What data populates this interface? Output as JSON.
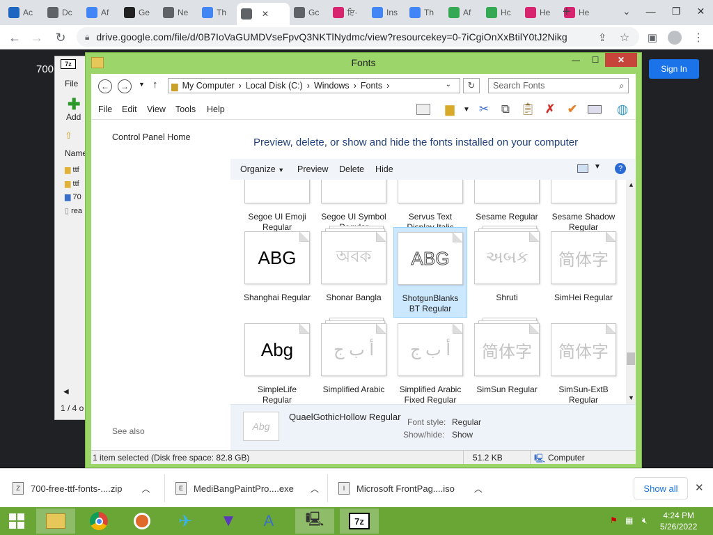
{
  "browser": {
    "tabs": [
      {
        "title": "Ac",
        "icon": "a-icon",
        "color": "#1f66c1"
      },
      {
        "title": "Dc",
        "icon": "globe-icon",
        "color": "#5f6368"
      },
      {
        "title": "Af",
        "icon": "map-pin-icon",
        "color": "#4285f4"
      },
      {
        "title": "Ge",
        "icon": "g-icon",
        "color": "#222222"
      },
      {
        "title": "Ne",
        "icon": "chrome-icon",
        "color": "#5f6368"
      },
      {
        "title": "Th",
        "icon": "map-pin-icon",
        "color": "#4285f4"
      },
      {
        "title": "",
        "icon": "globe-icon",
        "color": "#5f6368",
        "active": true
      },
      {
        "title": "Gc",
        "icon": "globe-icon",
        "color": "#5f6368"
      },
      {
        "title": "ਇ·",
        "icon": "ampersand-icon",
        "color": "#d6246e"
      },
      {
        "title": "Ins",
        "icon": "map-pin-icon",
        "color": "#4285f4"
      },
      {
        "title": "Th",
        "icon": "map-pin-icon",
        "color": "#4285f4"
      },
      {
        "title": "Af",
        "icon": "circle-icon",
        "color": "#34a853"
      },
      {
        "title": "Hc",
        "icon": "circle-icon",
        "color": "#34a853"
      },
      {
        "title": "He",
        "icon": "ampersand-icon",
        "color": "#d6246e"
      },
      {
        "title": "He",
        "icon": "ampersand-icon",
        "color": "#d6246e"
      }
    ],
    "tab_close": "✕",
    "new_tab": "+",
    "url": "drive.google.com/file/d/0B7IoVaGUMDVseFpvQ3NKTlNydmc/view?resourcekey=0-7iCgiOnXxBtilY0tJ2Nikg"
  },
  "page": {
    "page_number": "700",
    "sign_in": "Sign In"
  },
  "sevenzip": {
    "menu_file": "File",
    "add_label": "Add",
    "col_name": "Name",
    "rows": [
      "ttf",
      "ttf",
      "70",
      "rea"
    ],
    "footer": "1 / 4 o"
  },
  "explorer": {
    "title": "Fonts",
    "breadcrumb": [
      "My Computer",
      "Local Disk (C:)",
      "Windows",
      "Fonts"
    ],
    "search_placeholder": "Search Fonts",
    "menu": [
      "File",
      "Edit",
      "View",
      "Tools",
      "Help"
    ],
    "left_link": "Control Panel Home",
    "see_also": "See also",
    "heading": "Preview, delete, or show and hide the fonts installed on your computer",
    "commands": [
      "Organize",
      "Preview",
      "Delete",
      "Hide"
    ],
    "partial_row": [
      {
        "line1": "Segoe UI Emoji",
        "line2": "Regular"
      },
      {
        "line1": "Segoe UI Symbol",
        "line2": "Regular"
      },
      {
        "line1": "Servus Text",
        "line2": "Display Italic"
      },
      {
        "line1": "Sesame Regular",
        "line2": ""
      },
      {
        "line1": "Sesame Shadow",
        "line2": "Regular"
      }
    ],
    "row2": [
      {
        "preview": "ABG",
        "line1": "Shanghai Regular",
        "line2": "",
        "style": "brush",
        "stack": false
      },
      {
        "preview": "অবক",
        "line1": "Shonar Bangla",
        "line2": "",
        "style": "faded",
        "stack": true
      },
      {
        "preview": "ABG",
        "line1": "ShotgunBlanks",
        "line2": "BT Regular",
        "style": "outline",
        "stack": false,
        "selected": true
      },
      {
        "preview": "અબક",
        "line1": "Shruti",
        "line2": "",
        "style": "faded",
        "stack": true
      },
      {
        "preview": "简体字",
        "line1": "SimHei Regular",
        "line2": "",
        "style": "faded",
        "stack": false
      }
    ],
    "row3": [
      {
        "preview": "Abg",
        "line1": "SimpleLife",
        "line2": "Regular",
        "style": "bold",
        "stack": false
      },
      {
        "preview": "أ ب ج",
        "line1": "Simplified Arabic",
        "line2": "",
        "style": "faded",
        "stack": true
      },
      {
        "preview": "أ ب ج",
        "line1": "Simplified Arabic",
        "line2": "Fixed Regular",
        "style": "faded",
        "stack": false
      },
      {
        "preview": "简体字",
        "line1": "SimSun Regular",
        "line2": "",
        "style": "faded",
        "stack": true
      },
      {
        "preview": "简体字",
        "line1": "SimSun-ExtB",
        "line2": "Regular",
        "style": "faded",
        "stack": false
      }
    ],
    "details": {
      "thumb": "Abg",
      "name": "QuaelGothicHollow Regular",
      "style_label": "Font style:",
      "style_value": "Regular",
      "showhide_label": "Show/hide:",
      "showhide_value": "Show"
    },
    "status": {
      "selection": "1 item selected (Disk free space: 82.8 GB)",
      "size": "51.2 KB",
      "location": "Computer"
    }
  },
  "downloads": {
    "items": [
      "700-free-ttf-fonts-....zip",
      "MediBangPaintPro....exe",
      "Microsoft FrontPag....iso"
    ],
    "show_all": "Show all"
  },
  "taskbar": {
    "time": "4:24 PM",
    "date": "5/26/2022",
    "seven_zip_label": "7z"
  },
  "colors": {
    "window_frame": "#9cd66a",
    "taskbar": "#6aa636",
    "heading": "#1f3f7a",
    "selection": "#cce8ff",
    "sign_in": "#1a73e8"
  }
}
